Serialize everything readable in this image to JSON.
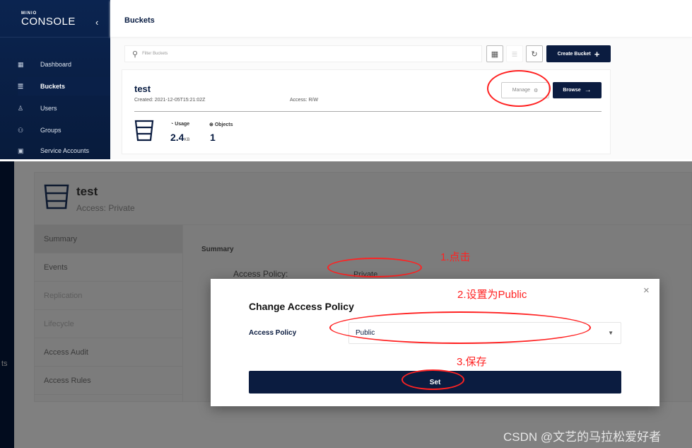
{
  "sidebar": {
    "logo_small": "MINIO",
    "logo": "CONSOLE",
    "collapse": "‹",
    "items": [
      {
        "label": "Dashboard",
        "icon": "dashboard-icon"
      },
      {
        "label": "Buckets",
        "icon": "bucket-icon",
        "active": true
      },
      {
        "label": "Users",
        "icon": "user-icon"
      },
      {
        "label": "Groups",
        "icon": "groups-icon"
      },
      {
        "label": "Service Accounts",
        "icon": "service-account-icon"
      }
    ]
  },
  "header": {
    "title": "Buckets"
  },
  "toolbar": {
    "search_placeholder": "Filter Buckets",
    "create_label": "Create Bucket"
  },
  "bucket": {
    "name": "test",
    "created": "Created: 2021-12-05T15:21:02Z",
    "access": "Access: R/W",
    "manage_label": "Manage",
    "browse_label": "Browse",
    "usage_label": "Usage",
    "usage_value": "2.4",
    "usage_unit": "KB",
    "objects_label": "Objects",
    "objects_value": "1"
  },
  "detail": {
    "name": "test",
    "access": "Access: Private",
    "sidebar_fragment": "ts",
    "tabs": [
      "Summary",
      "Events",
      "Replication",
      "Lifecycle",
      "Access Audit",
      "Access Rules"
    ],
    "summary_title": "Summary",
    "policy_label": "Access Policy:",
    "policy_value": "Private"
  },
  "modal": {
    "title": "Change Access Policy",
    "field_label": "Access Policy",
    "selected": "Public",
    "set_label": "Set",
    "close": "×"
  },
  "annotations": {
    "step1": "1.点击",
    "step2": "2.设置为Public",
    "step3": "3.保存",
    "color": "#ff2222"
  },
  "watermark": "CSDN @文艺的马拉松爱好者",
  "colors": {
    "brand": "#0b1c40",
    "overlay": "#808080"
  }
}
